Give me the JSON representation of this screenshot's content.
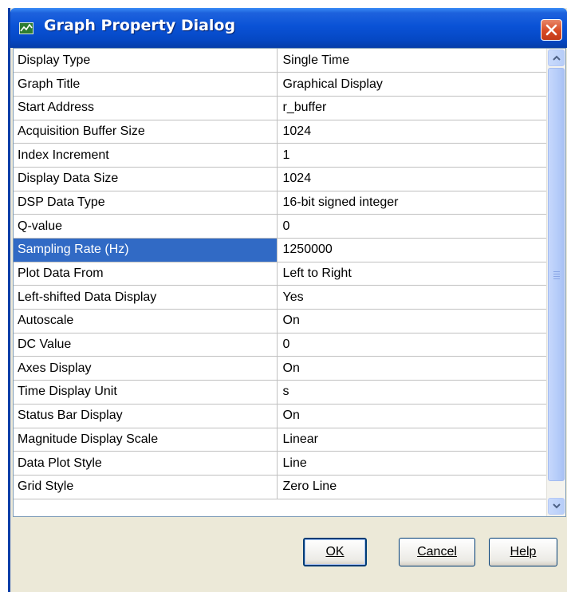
{
  "window": {
    "title": "Graph Property Dialog"
  },
  "properties": [
    {
      "key": "Display Type",
      "value": "Single Time"
    },
    {
      "key": "Graph Title",
      "value": "Graphical Display"
    },
    {
      "key": "Start Address",
      "value": "r_buffer"
    },
    {
      "key": "Acquisition Buffer Size",
      "value": "1024"
    },
    {
      "key": "Index Increment",
      "value": "1"
    },
    {
      "key": "Display Data Size",
      "value": "1024"
    },
    {
      "key": "DSP Data Type",
      "value": "16-bit signed integer"
    },
    {
      "key": "Q-value",
      "value": "0"
    },
    {
      "key": "Sampling Rate (Hz)",
      "value": "1250000"
    },
    {
      "key": "Plot Data From",
      "value": "Left to Right"
    },
    {
      "key": "Left-shifted Data Display",
      "value": "Yes"
    },
    {
      "key": "Autoscale",
      "value": "On"
    },
    {
      "key": "DC Value",
      "value": "0"
    },
    {
      "key": "Axes Display",
      "value": "On"
    },
    {
      "key": "Time Display Unit",
      "value": "s"
    },
    {
      "key": "Status Bar Display",
      "value": "On"
    },
    {
      "key": "Magnitude Display Scale",
      "value": "Linear"
    },
    {
      "key": "Data Plot Style",
      "value": "Line"
    },
    {
      "key": "Grid Style",
      "value": "Zero Line"
    }
  ],
  "selected_property": "Sampling Rate (Hz)",
  "buttons": {
    "ok": "OK",
    "cancel": "Cancel",
    "help": "Help"
  },
  "colors": {
    "titlebar": "#0a52d6",
    "selection": "#316ac5",
    "close": "#d74a24",
    "dialog_bg": "#ece9d8"
  },
  "icons": {
    "app": "graph-window-icon",
    "close": "close-icon",
    "scroll_up": "scroll-up-arrow-icon",
    "scroll_down": "scroll-down-arrow-icon"
  }
}
